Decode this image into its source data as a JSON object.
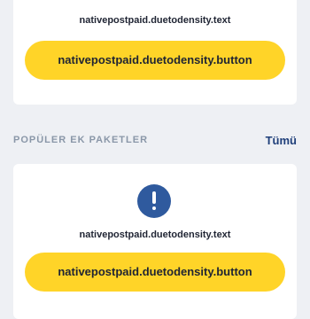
{
  "top_card": {
    "text": "nativepostpaid.duetodensity.text",
    "button_label": "nativepostpaid.duetodensity.button"
  },
  "section": {
    "title": "POPÜLER EK PAKETLER",
    "see_all_label": "Tümü"
  },
  "bottom_card": {
    "icon": "exclamation-icon",
    "text": "nativepostpaid.duetodensity.text",
    "button_label": "nativepostpaid.duetodensity.button"
  },
  "colors": {
    "accent_yellow": "#ffd428",
    "icon_blue": "#2f5a9e",
    "link_blue": "#1f3f7a",
    "section_gray": "#8a97a8",
    "background": "#eef0f4"
  }
}
